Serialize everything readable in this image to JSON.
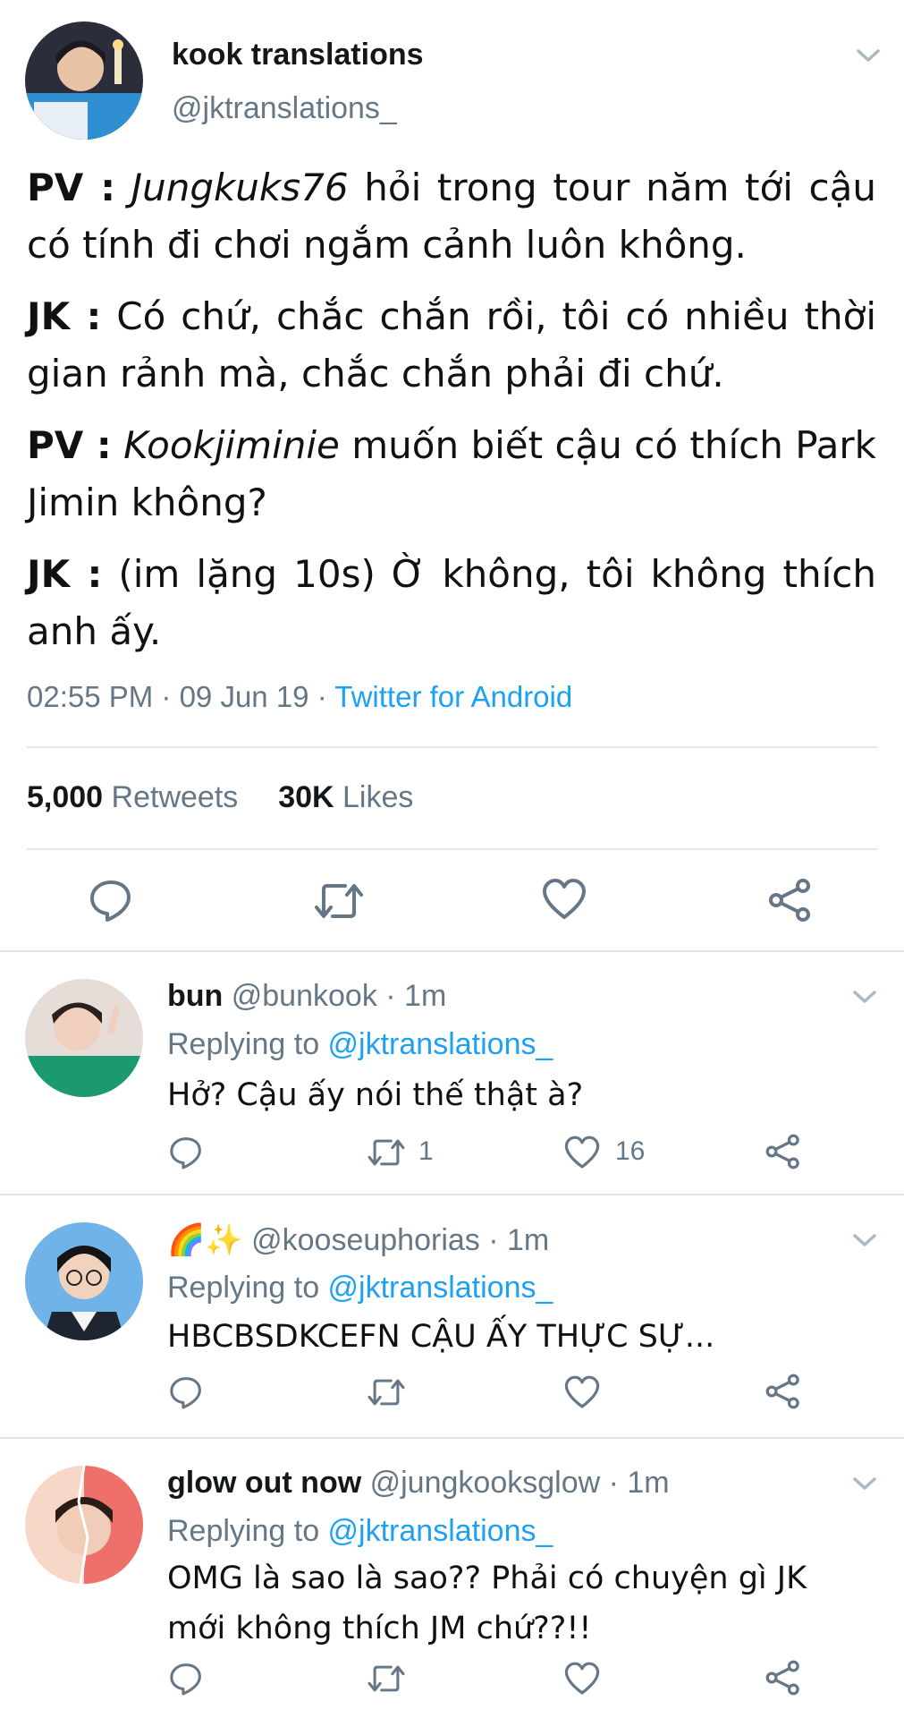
{
  "main_tweet": {
    "display_name": "kook translations",
    "handle": "@jktranslations_",
    "body": [
      {
        "speaker": "PV :",
        "italic": "Jungkuks76",
        "text": " hỏi trong tour năm tới cậu có tính đi chơi ngắm cảnh luôn không."
      },
      {
        "speaker": "JK  :",
        "italic": "",
        "text": " Có chứ, chắc chắn rồi, tôi có nhiều thời gian rảnh mà, chắc chắn phải đi chứ."
      },
      {
        "speaker": "PV :",
        "italic": "Kookjiminie",
        "text": " muốn biết cậu có thích Park Jimin không?"
      },
      {
        "speaker": "JK :",
        "italic": "",
        "text": " (im lặng 10s) Ờ không, tôi không thích anh ấy."
      }
    ],
    "time": "02:55 PM · 09 Jun 19 · ",
    "source": "Twitter for Android",
    "retweets_count": "5,000",
    "retweets_label": " Retweets",
    "likes_count": "30K",
    "likes_label": " Likes",
    "icons": [
      "reply-icon",
      "retweet-icon",
      "like-icon",
      "share-icon"
    ]
  },
  "replies": [
    {
      "display_name": "bun",
      "handle_time": " @bunkook · 1m",
      "replying_prefix": "Replying to ",
      "replying_to": "@jktranslations_",
      "text": "Hở? Cậu ấy nói thế thật à?",
      "retweets": "1",
      "likes": "16"
    },
    {
      "display_name": "🌈✨",
      "handle_time": " @kooseuphorias · 1m",
      "replying_prefix": "Replying to ",
      "replying_to": "@jktranslations_",
      "text": "HBCBSDKCEFN CẬU ẤY THỰC SỰ...",
      "retweets": "",
      "likes": ""
    },
    {
      "display_name": "glow out now",
      "handle_time": " @jungkooksglow · 1m",
      "replying_prefix": "Replying to ",
      "replying_to": "@jktranslations_",
      "text": "OMG là sao là sao?? Phải có chuyện gì JK mới không thích JM chứ??!!",
      "retweets": "",
      "likes": ""
    }
  ],
  "colors": {
    "link": "#1da1f2",
    "secondary": "#657786",
    "divider": "#e1e8ed"
  }
}
